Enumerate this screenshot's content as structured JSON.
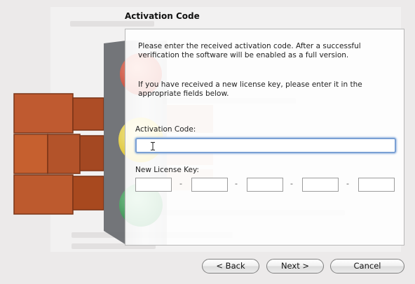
{
  "dialog": {
    "title": "Activation Code"
  },
  "content": {
    "intro_line1": "Please enter the received activation code. After a successful",
    "intro_line2": "verification the software will be enabled as a full version.",
    "license_line1": "If you have received a new license key, please enter it in the",
    "license_line2": "appropriate fields below.",
    "activation_code_label": "Activation Code:",
    "activation_code_value": "",
    "new_license_key_label": "New License Key:",
    "key_separator": "-",
    "key_fields": [
      "",
      "",
      "",
      "",
      ""
    ]
  },
  "buttons": {
    "back": "< Back",
    "next": "Next >",
    "cancel": "Cancel"
  },
  "colors": {
    "focus_ring": "#7aa0d4",
    "light_red": "#e04a3a",
    "light_yellow": "#f2d623",
    "light_green": "#2fa04a",
    "brick": "#c4582f"
  },
  "icons": {
    "cursor": "text-cursor-icon",
    "traffic_light": "traffic-light-icon",
    "brick_wall": "brick-wall-icon"
  }
}
